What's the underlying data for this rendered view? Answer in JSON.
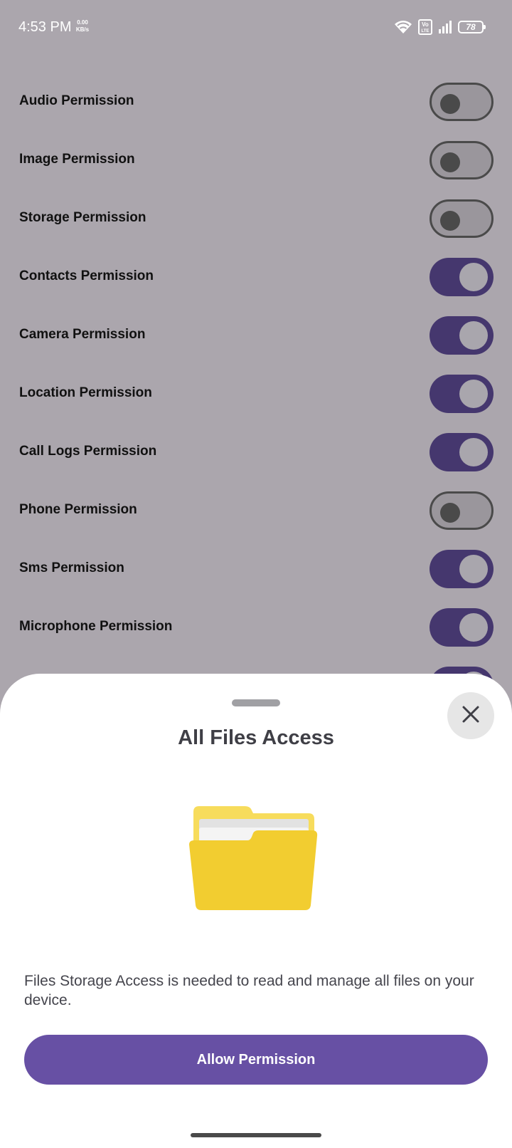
{
  "status_bar": {
    "time": "4:53 PM",
    "speed_value": "0.00",
    "speed_unit": "KB/s",
    "battery_level": "78",
    "volte_label_top": "Vo",
    "volte_label_bottom": "LTE",
    "icons": [
      "wifi-icon",
      "volte-icon",
      "signal-icon",
      "battery-icon"
    ]
  },
  "permissions": [
    {
      "label": "Audio Permission",
      "enabled": false
    },
    {
      "label": "Image Permission",
      "enabled": false
    },
    {
      "label": "Storage Permission",
      "enabled": false
    },
    {
      "label": "Contacts Permission",
      "enabled": true
    },
    {
      "label": "Camera Permission",
      "enabled": true
    },
    {
      "label": "Location Permission",
      "enabled": true
    },
    {
      "label": "Call Logs Permission",
      "enabled": true
    },
    {
      "label": "Phone Permission",
      "enabled": false
    },
    {
      "label": "Sms Permission",
      "enabled": true
    },
    {
      "label": "Microphone Permission",
      "enabled": true
    },
    {
      "label": "",
      "enabled": true
    }
  ],
  "sheet": {
    "title": "All Files Access",
    "illustration_icon": "folder-icon",
    "description": "Files Storage Access is needed to read and manage all files on your device.",
    "allow_button_label": "Allow Permission",
    "close_icon": "close-icon"
  },
  "colors": {
    "overlay_background": "#aba6ad",
    "toggle_on": "#45376e",
    "primary_button": "#6750a4",
    "folder_yellow": "#f2cd30"
  }
}
